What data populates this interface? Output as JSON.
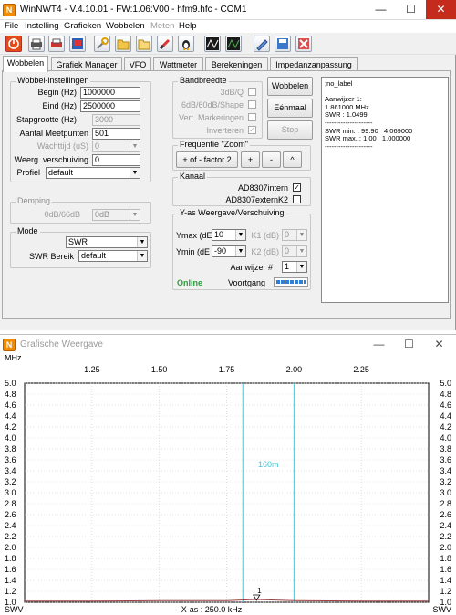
{
  "main_window": {
    "title": "WinNWT4 - V.4.10.01 - FW:1.06:V00 - hfm9.hfc - COM1",
    "icon_letter": "N",
    "controls": {
      "minimize": "—",
      "maximize": "☐",
      "close": "✕"
    }
  },
  "menu": {
    "items": [
      {
        "label": "File",
        "disabled": false
      },
      {
        "label": "Instelling",
        "disabled": false
      },
      {
        "label": "Grafieken",
        "disabled": false
      },
      {
        "label": "Wobbelen",
        "disabled": false
      },
      {
        "label": "Meten",
        "disabled": true
      },
      {
        "label": "Help",
        "disabled": false
      }
    ]
  },
  "toolbar": {
    "icons": [
      "power-icon",
      "printer-icon",
      "print-color-icon",
      "screen-print-icon",
      "tools-icon",
      "folder-open-icon",
      "folder-icon",
      "wand-icon",
      "tux-icon",
      "sweep-icon",
      "sweep-info-icon",
      "pen-icon",
      "save-icon",
      "delete-icon"
    ]
  },
  "tabs": {
    "items": [
      {
        "label": "Wobbelen",
        "active": true
      },
      {
        "label": "Grafiek Manager",
        "active": false
      },
      {
        "label": "VFO",
        "active": false
      },
      {
        "label": "Wattmeter",
        "active": false
      },
      {
        "label": "Berekeningen",
        "active": false
      },
      {
        "label": "Impedanzanpassung",
        "active": false
      }
    ]
  },
  "wobbel": {
    "title": "Wobbel-instellingen",
    "begin_label": "Begin (Hz)",
    "begin_value": "1000000",
    "eind_label": "Eind (Hz)",
    "eind_value": "2500000",
    "stap_label": "Stapgrootte (Hz)",
    "stap_value": "3000",
    "meetpunten_label": "Aantal Meetpunten",
    "meetpunten_value": "501",
    "wacht_label": "Wachttijd (uS)",
    "wacht_value": "0",
    "weerg_label": "Weerg. verschuiving",
    "weerg_value": "0",
    "profiel_label": "Profiel",
    "profiel_value": "default"
  },
  "demping": {
    "title": "Demping",
    "label": "0dB/66dB",
    "value": "0dB"
  },
  "mode": {
    "title": "Mode",
    "mode_value": "SWR",
    "bereik_label": "SWR Bereik",
    "bereik_value": "default"
  },
  "bandbreedte": {
    "title": "Bandbreedte",
    "items": [
      {
        "label": "3dB/Q",
        "checked": false
      },
      {
        "label": "6dB/60dB/Shape",
        "checked": false
      },
      {
        "label": "Vert. Markeringen",
        "checked": false
      },
      {
        "label": "Inverteren",
        "checked": true
      }
    ]
  },
  "buttons": {
    "wobbelen": "Wobbelen",
    "eenmaal": "Eénmaal",
    "stop": "Stop"
  },
  "zoom": {
    "title": "Frequentie \"Zoom\"",
    "factor": "+ of - factor 2",
    "plus": "+",
    "minus": "-",
    "caret": "^"
  },
  "kanaal": {
    "title": "Kanaal",
    "intern_label": "AD8307intern",
    "intern_checked": true,
    "extern_label": "AD8307externK2",
    "extern_checked": false
  },
  "yas": {
    "title": "Y-as  Weergave/Verschuiving",
    "ymax_label": "Ymax (dE",
    "ymax_value": "10",
    "ymin_label": "Ymin (dE",
    "ymin_value": "-90",
    "k1_label": "K1 (dB)",
    "k1_value": "0",
    "k2_label": "K2 (dB)",
    "k2_value": "0",
    "aanwijzer_label": "Aanwijzer #",
    "aanwijzer_value": "1",
    "online": "Online",
    "voortgang": "Voortgang",
    "voortgang_fraction": 1.0
  },
  "info_panel": {
    "text": ";no_label\n\nAanwijzer 1:\n1.861000 MHz\nSWR : 1.0499\n---------------------\nSWR min. : 99.90   4.069000\nSWR max. : 1.00   1.000000\n---------------------"
  },
  "graph_window": {
    "title": "Grafische Weergave",
    "icon_letter": "N",
    "controls": {
      "minimize": "—",
      "maximize": "☐",
      "close": "✕"
    }
  },
  "chart_data": {
    "type": "line",
    "x_unit_label": "MHz",
    "x_ticks": [
      {
        "value": 1.25,
        "label": "1.25"
      },
      {
        "value": 1.5,
        "label": "1.50"
      },
      {
        "value": 1.75,
        "label": "1.75"
      },
      {
        "value": 2.0,
        "label": "2.00"
      },
      {
        "value": 2.25,
        "label": "2.25"
      }
    ],
    "xlim": [
      1.0,
      2.5
    ],
    "ylim": [
      1.0,
      5.0
    ],
    "y_ticks": [
      "5.0",
      "4.8",
      "4.6",
      "4.4",
      "4.2",
      "4.0",
      "3.8",
      "3.6",
      "3.4",
      "3.2",
      "3.0",
      "2.8",
      "2.6",
      "2.4",
      "2.2",
      "2.0",
      "1.8",
      "1.6",
      "1.4",
      "1.2",
      "1.0"
    ],
    "y_label_left": "SWV",
    "y_label_right": "SWV",
    "x_axis_caption": "X-as : 250.0 kHz",
    "band_label": "160m",
    "band_lines": [
      1.81,
      2.0
    ],
    "marker": {
      "label": "1",
      "x": 1.861
    },
    "series": [
      {
        "color": "#a04040",
        "x": [
          1.0,
          1.25,
          1.5,
          1.75,
          1.861,
          2.0,
          2.25,
          2.5
        ],
        "y": [
          1.02,
          1.02,
          1.03,
          1.03,
          1.05,
          1.03,
          1.02,
          1.02
        ]
      }
    ],
    "grid": true,
    "colors": {
      "grid": "#c8c8c8",
      "band": "#3fc6d6",
      "trace": "#a04040"
    }
  }
}
